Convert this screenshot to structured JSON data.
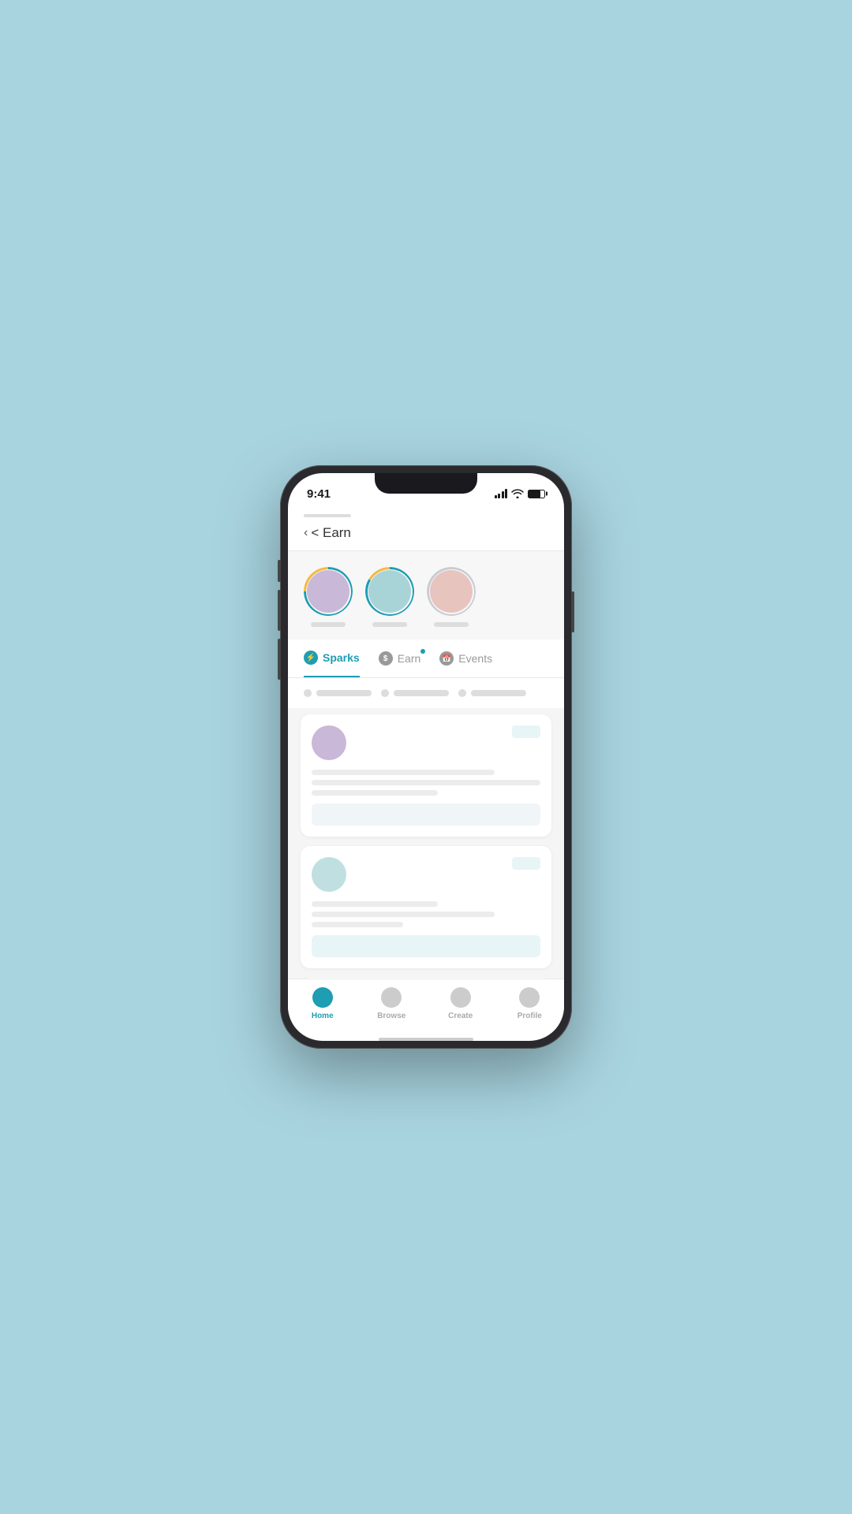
{
  "status_bar": {
    "time": "9:41"
  },
  "header": {
    "back_label": "< Earn"
  },
  "stories": [
    {
      "ring_class": "purple-ring",
      "avatar_color": "purple-avatar",
      "label": ""
    },
    {
      "ring_class": "green-ring",
      "avatar_color": "teal-avatar",
      "label": ""
    },
    {
      "ring_class": "pink-ring",
      "avatar_color": "teal-light",
      "label": ""
    }
  ],
  "tabs": [
    {
      "id": "sparks",
      "label": "Sparks",
      "icon": "⚡",
      "active": true,
      "dot": false
    },
    {
      "id": "earn",
      "label": "Earn",
      "icon": "$",
      "active": false,
      "dot": true
    },
    {
      "id": "events",
      "label": "Events",
      "icon": "📅",
      "active": false,
      "dot": false
    }
  ],
  "filter_chips": [
    {
      "id": "filter1"
    },
    {
      "id": "filter2"
    },
    {
      "id": "filter3"
    }
  ],
  "cards": [
    {
      "avatar_color": "purple-avatar"
    },
    {
      "avatar_color": "teal-avatar"
    }
  ],
  "bottom_nav": [
    {
      "id": "home",
      "label": "Home",
      "active": true
    },
    {
      "id": "nav2",
      "label": "Browse",
      "active": false
    },
    {
      "id": "nav3",
      "label": "Create",
      "active": false
    },
    {
      "id": "nav4",
      "label": "Profile",
      "active": false
    }
  ],
  "colors": {
    "teal": "#1e9db3",
    "background": "#a8d4e0"
  }
}
